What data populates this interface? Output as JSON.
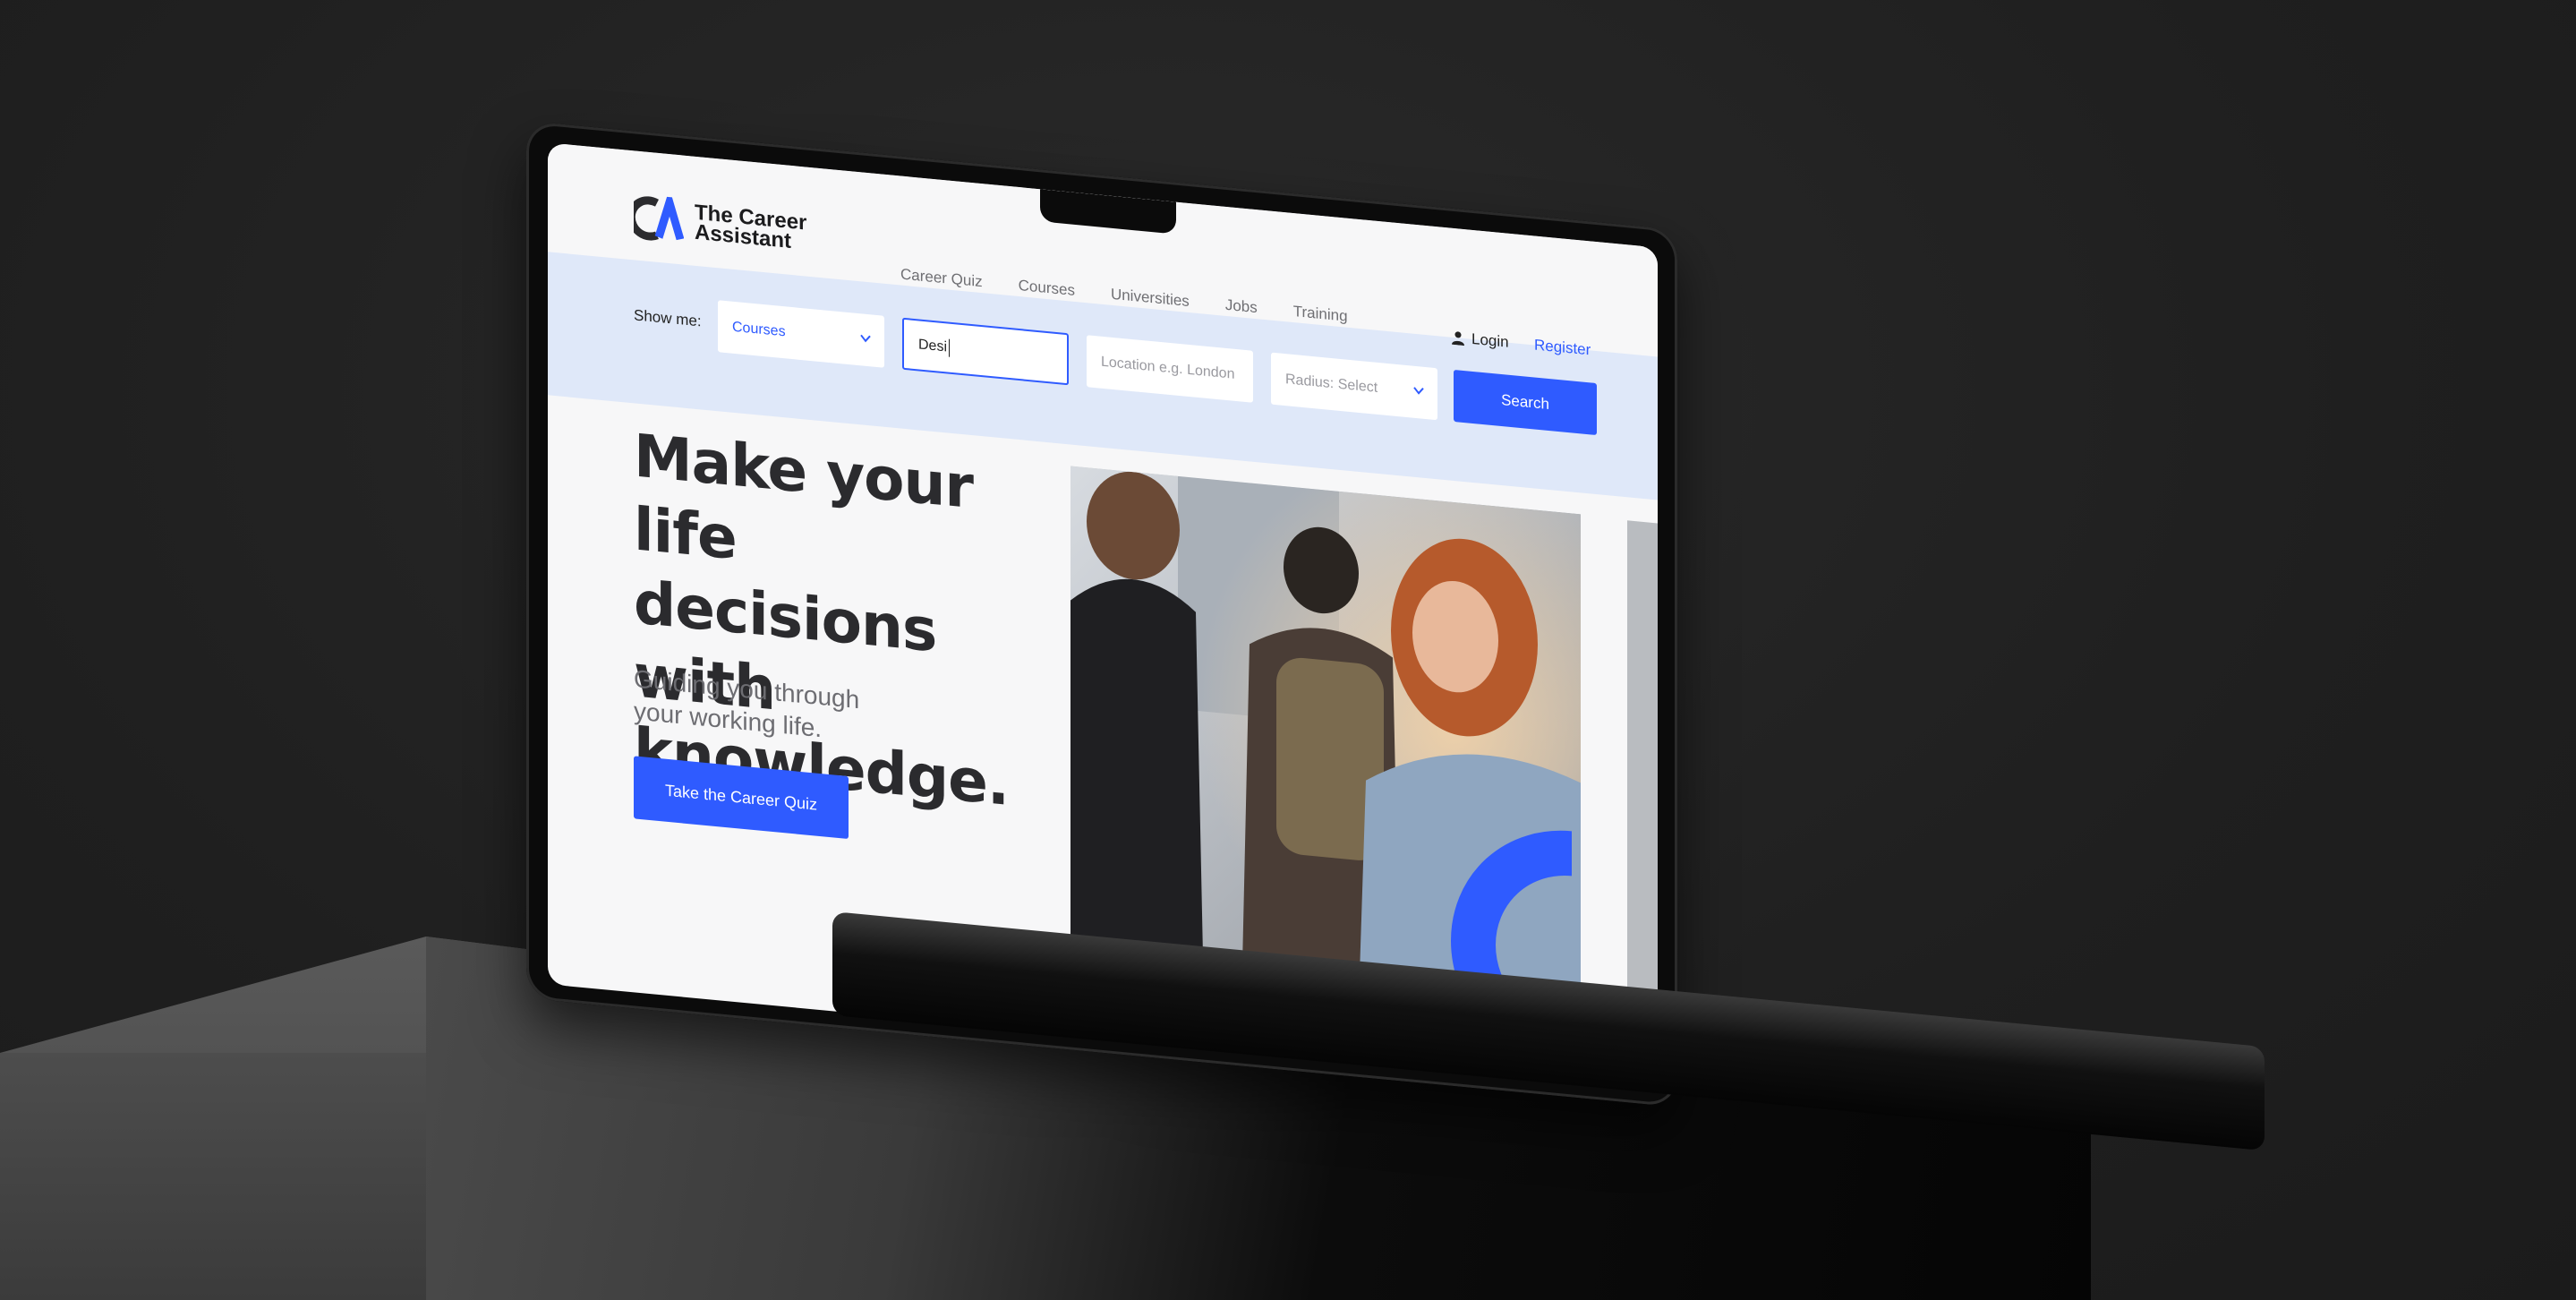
{
  "brand": {
    "name_line1": "The Career",
    "name_line2": "Assistant",
    "accent_color": "#2f5bff"
  },
  "nav": {
    "items": [
      {
        "label": "Career Quiz"
      },
      {
        "label": "Courses"
      },
      {
        "label": "Universities"
      },
      {
        "label": "Jobs"
      },
      {
        "label": "Training"
      }
    ],
    "login_label": "Login",
    "register_label": "Register"
  },
  "search": {
    "show_me_label": "Show me:",
    "category_value": "Courses",
    "keyword_value": "Desi",
    "location_placeholder": "Location e.g. London",
    "radius_value": "Radius: Select",
    "search_button": "Search"
  },
  "hero": {
    "title": "Make your life decisions with knowledge.",
    "subtitle": "Guiding you through your working life.",
    "cta_label": "Take the Career Quiz"
  }
}
